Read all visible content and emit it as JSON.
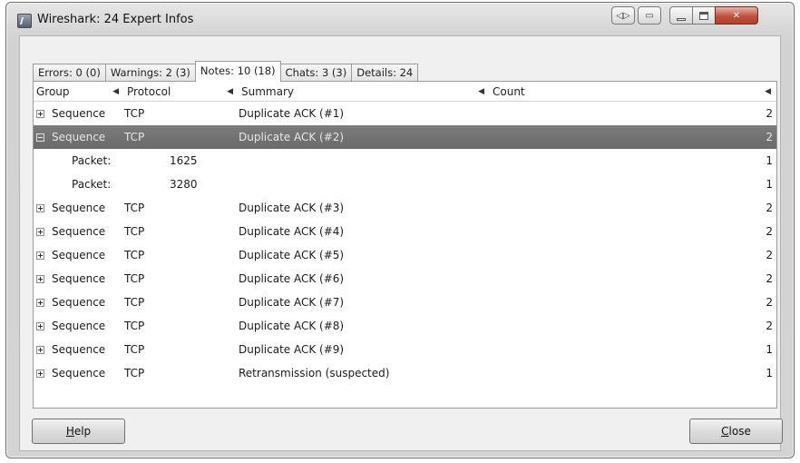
{
  "window": {
    "title": "Wireshark: 24 Expert Infos"
  },
  "tabs": [
    {
      "label": "Errors: 0 (0)",
      "active": false
    },
    {
      "label": "Warnings: 2 (3)",
      "active": false
    },
    {
      "label": "Notes: 10 (18)",
      "active": true
    },
    {
      "label": "Chats: 3 (3)",
      "active": false
    },
    {
      "label": "Details: 24",
      "active": false
    }
  ],
  "table": {
    "columns": [
      "Group",
      "Protocol",
      "Summary",
      "Count"
    ],
    "rows": [
      {
        "kind": "group",
        "expanded": false,
        "group": "Sequence",
        "protocol": "TCP",
        "summary": "Duplicate ACK (#1)",
        "count": "2"
      },
      {
        "kind": "group",
        "expanded": true,
        "selected": true,
        "group": "Sequence",
        "protocol": "TCP",
        "summary": "Duplicate ACK (#2)",
        "count": "2"
      },
      {
        "kind": "packet",
        "label": "Packet:",
        "number": "1625",
        "count": "1"
      },
      {
        "kind": "packet",
        "label": "Packet:",
        "number": "3280",
        "count": "1"
      },
      {
        "kind": "group",
        "expanded": false,
        "group": "Sequence",
        "protocol": "TCP",
        "summary": "Duplicate ACK (#3)",
        "count": "2"
      },
      {
        "kind": "group",
        "expanded": false,
        "group": "Sequence",
        "protocol": "TCP",
        "summary": "Duplicate ACK (#4)",
        "count": "2"
      },
      {
        "kind": "group",
        "expanded": false,
        "group": "Sequence",
        "protocol": "TCP",
        "summary": "Duplicate ACK (#5)",
        "count": "2"
      },
      {
        "kind": "group",
        "expanded": false,
        "group": "Sequence",
        "protocol": "TCP",
        "summary": "Duplicate ACK (#6)",
        "count": "2"
      },
      {
        "kind": "group",
        "expanded": false,
        "group": "Sequence",
        "protocol": "TCP",
        "summary": "Duplicate ACK (#7)",
        "count": "2"
      },
      {
        "kind": "group",
        "expanded": false,
        "group": "Sequence",
        "protocol": "TCP",
        "summary": "Duplicate ACK (#8)",
        "count": "2"
      },
      {
        "kind": "group",
        "expanded": false,
        "group": "Sequence",
        "protocol": "TCP",
        "summary": "Duplicate ACK (#9)",
        "count": "1"
      },
      {
        "kind": "group",
        "expanded": false,
        "group": "Sequence",
        "protocol": "TCP",
        "summary": "Retransmission (suspected)",
        "count": "1"
      }
    ]
  },
  "buttons": {
    "help": "Help",
    "close": "Close"
  },
  "icons": {
    "app": "wireshark-app-icon",
    "sort": "sort-arrow-icon",
    "expand": "tree-expander-icon"
  },
  "colors": {
    "selected_row": "#727272",
    "close_button": "#c2513c"
  }
}
